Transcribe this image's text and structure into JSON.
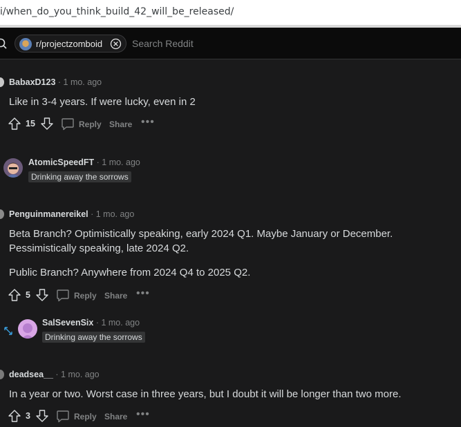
{
  "browser": {
    "url": "i/when_do_you_think_build_42_will_be_released/"
  },
  "header": {
    "subreddit": "r/projectzomboid",
    "search_placeholder": "Search Reddit"
  },
  "actions": {
    "reply": "Reply",
    "share": "Share"
  },
  "comments": [
    {
      "author": "BabaxD123",
      "time": "1 mo. ago",
      "paragraphs": [
        "Like in 3-4 years. If were lucky, even in 2"
      ],
      "votes": "15"
    },
    {
      "author": "AtomicSpeedFT",
      "time": "1 mo. ago",
      "flair": "Drinking away the sorrows"
    },
    {
      "author": "Penguinmanereikel",
      "time": "1 mo. ago",
      "paragraphs": [
        "Beta Branch? Optimistically speaking, early 2024 Q1. Maybe January or December. Pessimistically speaking, late 2024 Q2.",
        "Public Branch? Anywhere from 2024 Q4 to 2025 Q2."
      ],
      "votes": "5"
    },
    {
      "author": "SalSevenSix",
      "time": "1 mo. ago",
      "flair": "Drinking away the sorrows"
    },
    {
      "author": "deadsea__",
      "time": "1 mo. ago",
      "paragraphs": [
        "In a year or two. Worst case in three years, but I doubt it will be longer than two more."
      ],
      "votes": "3"
    }
  ]
}
